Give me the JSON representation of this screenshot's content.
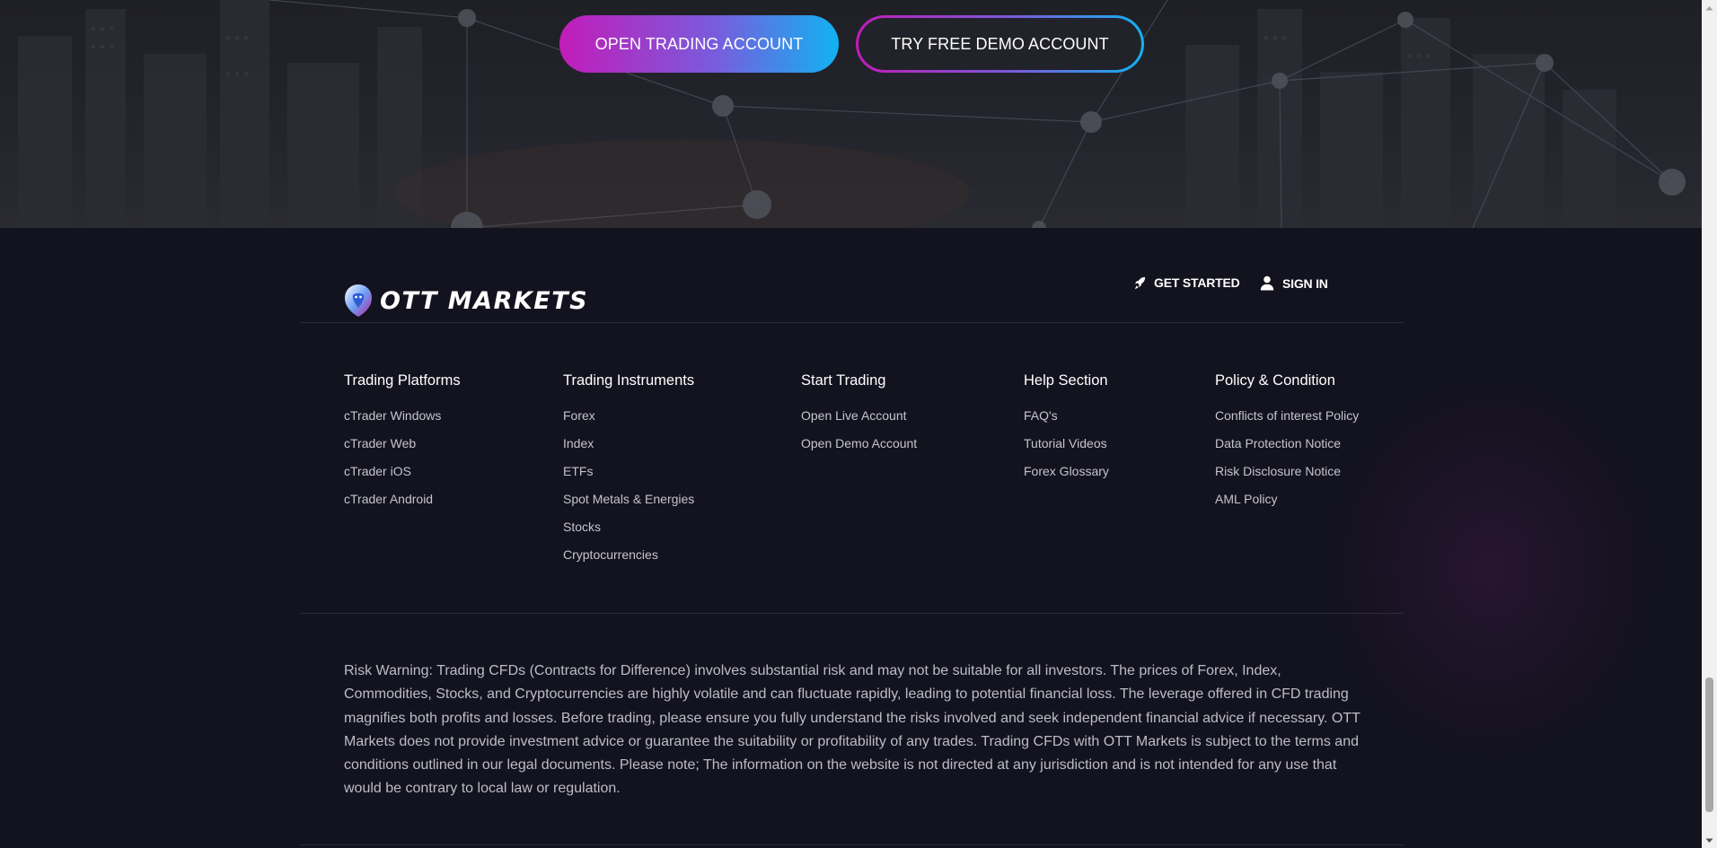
{
  "hero": {
    "primary_button": "OPEN TRADING ACCOUNT",
    "secondary_button": "TRY FREE DEMO ACCOUNT"
  },
  "header": {
    "logo_text": "OTT MARKETS",
    "get_started": "GET STARTED",
    "sign_in": "SIGN IN",
    "icons": [
      "rocket-icon",
      "user-icon"
    ]
  },
  "columns": {
    "platforms": {
      "title": "Trading Platforms",
      "items": [
        "cTrader Windows",
        "cTrader Web",
        "cTrader iOS",
        "cTrader Android"
      ]
    },
    "instruments": {
      "title": "Trading Instruments",
      "items": [
        "Forex",
        "Index",
        "ETFs",
        "Spot Metals & Energies",
        "Stocks",
        "Cryptocurrencies"
      ]
    },
    "start": {
      "title": "Start Trading",
      "items": [
        "Open Live Account",
        "Open Demo Account"
      ]
    },
    "help": {
      "title": "Help Section",
      "items": [
        "FAQ's",
        "Tutorial Videos",
        "Forex Glossary"
      ]
    },
    "policy": {
      "title": "Policy & Condition",
      "items": [
        "Conflicts of interest Policy",
        "Data Protection Notice",
        "Risk Disclosure Notice",
        "AML Policy"
      ]
    }
  },
  "risk_warning": "Risk Warning: Trading CFDs (Contracts for Difference) involves substantial risk and may not be suitable for all investors. The prices of Forex, Index, Commodities, Stocks, and Cryptocurrencies are highly volatile and can fluctuate rapidly, leading to potential financial loss. The leverage offered in CFD trading magnifies both profits and losses. Before trading, please ensure you fully understand the risks involved and seek independent financial advice if necessary. OTT Markets does not provide investment advice or guarantee the suitability or profitability of any trades. Trading CFDs with OTT Markets is subject to the terms and conditions outlined in our legal documents. Please note; The information on the website is not directed at any jurisdiction and is not intended for any use that would be contrary to local law or regulation.",
  "colors": {
    "background": "#13121f",
    "gradient_start": "#c21cb9",
    "gradient_end": "#11b2f2",
    "link_text": "#c5c5cd"
  }
}
